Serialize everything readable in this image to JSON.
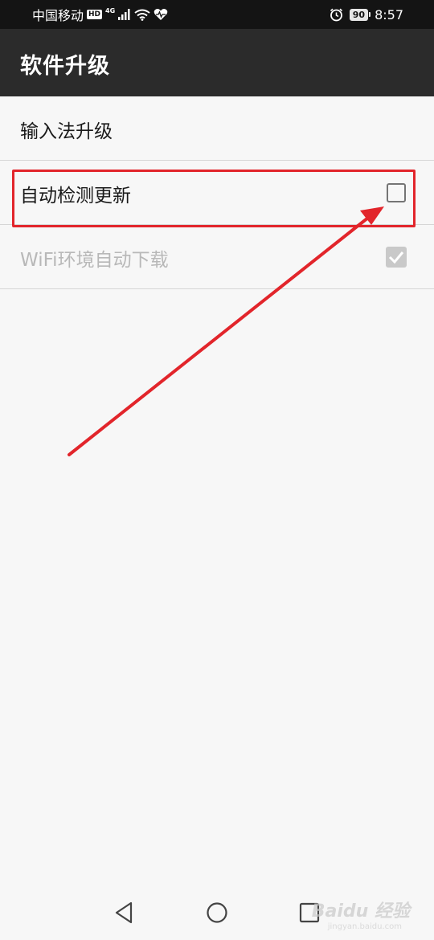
{
  "status_bar": {
    "carrier": "中国移动",
    "hd": "HD",
    "network": "4G",
    "battery": "90",
    "time": "8:57"
  },
  "app_bar": {
    "title": "软件升级"
  },
  "settings": [
    {
      "label": "输入法升级",
      "control": "none",
      "enabled": true
    },
    {
      "label": "自动检测更新",
      "control": "checkbox",
      "checked": false,
      "enabled": true
    },
    {
      "label": "WiFi环境自动下载",
      "control": "checkbox",
      "checked": true,
      "enabled": false
    }
  ],
  "annotation": {
    "color": "#e2252b",
    "target": "自动检测更新 checkbox"
  },
  "nav": {
    "icons": [
      "back-icon",
      "home-icon",
      "recent-apps-icon"
    ]
  },
  "watermark": {
    "text": "Baidu 经验",
    "sub": "jingyan.baidu.com"
  }
}
